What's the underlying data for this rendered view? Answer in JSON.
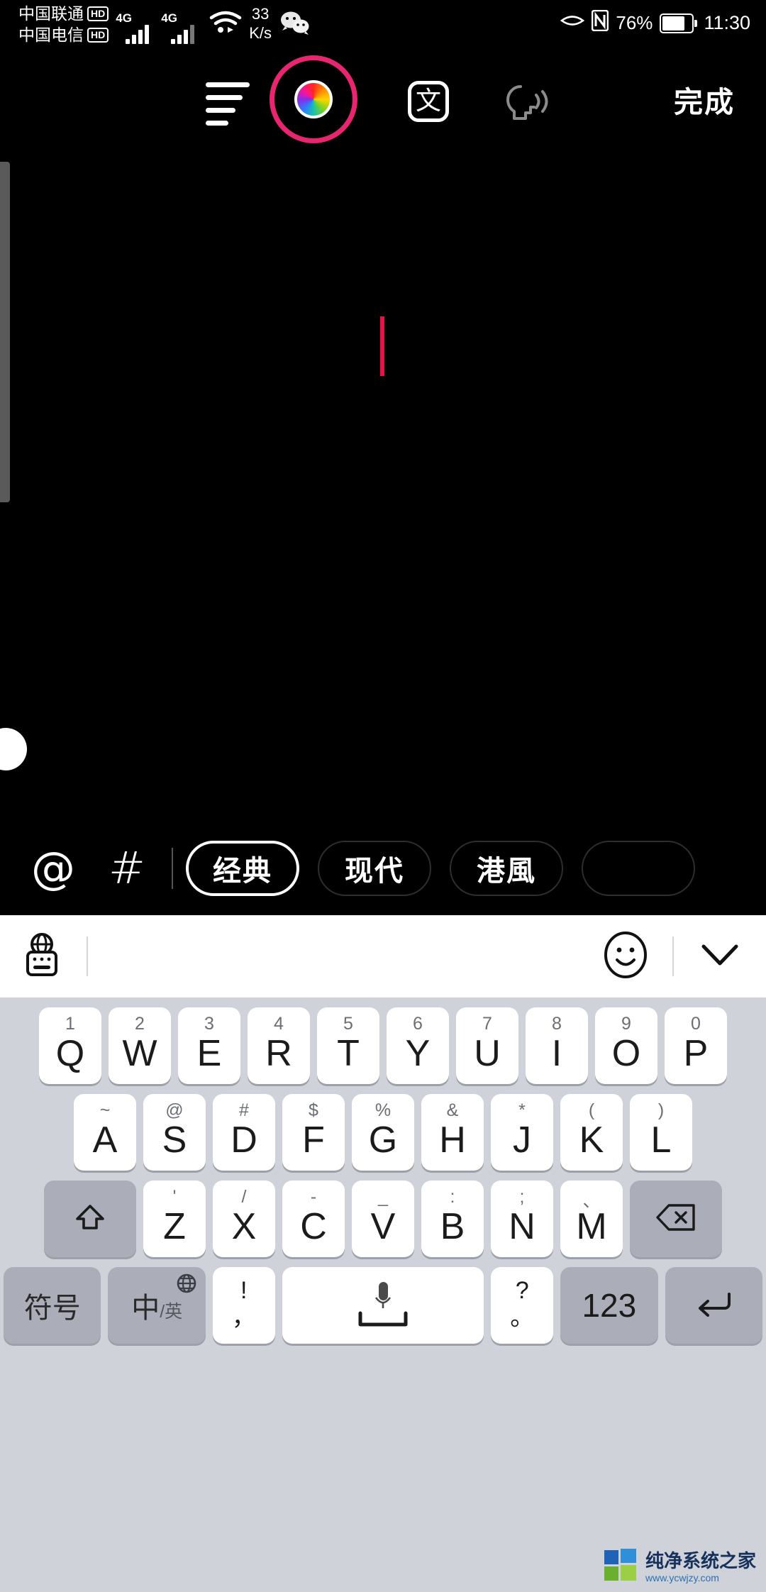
{
  "statusbar": {
    "carrier1": "中国联通",
    "carrier1_badge": "HD",
    "carrier2": "中国电信",
    "carrier2_badge": "HD",
    "network1": "4G",
    "network2": "4G",
    "netspeed_value": "33",
    "netspeed_unit": "K/s",
    "battery_percent": "76%",
    "clock": "11:30",
    "icons": [
      "wifi-icon",
      "wechat-icon",
      "eye-comfort-icon",
      "nfc-icon",
      "battery-icon"
    ]
  },
  "editor_toolbar": {
    "align_icon": "text-align-icon",
    "color_icon": "color-wheel-icon",
    "translate_label": "文",
    "speak_icon": "text-to-speech-icon",
    "done_label": "完成"
  },
  "canvas": {
    "caret_color": "#e8124a",
    "text_value": ""
  },
  "chipbar": {
    "mention_label": "@",
    "hashtag_label": "#",
    "styles": [
      {
        "label": "经典",
        "selected": true
      },
      {
        "label": "现代",
        "selected": false
      },
      {
        "label": "港風",
        "selected": false
      },
      {
        "label": "",
        "selected": false
      }
    ]
  },
  "keyboard": {
    "toolbar": {
      "ime_icon": "globe-keyboard-icon",
      "emoji_icon": "emoji-smiley-icon",
      "collapse_icon": "chevron-down-icon"
    },
    "row1": [
      {
        "sub": "1",
        "main": "Q"
      },
      {
        "sub": "2",
        "main": "W"
      },
      {
        "sub": "3",
        "main": "E"
      },
      {
        "sub": "4",
        "main": "R"
      },
      {
        "sub": "5",
        "main": "T"
      },
      {
        "sub": "6",
        "main": "Y"
      },
      {
        "sub": "7",
        "main": "U"
      },
      {
        "sub": "8",
        "main": "I"
      },
      {
        "sub": "9",
        "main": "O"
      },
      {
        "sub": "0",
        "main": "P"
      }
    ],
    "row2": [
      {
        "sub": "~",
        "main": "A"
      },
      {
        "sub": "@",
        "main": "S"
      },
      {
        "sub": "#",
        "main": "D"
      },
      {
        "sub": "$",
        "main": "F"
      },
      {
        "sub": "%",
        "main": "G"
      },
      {
        "sub": "&",
        "main": "H"
      },
      {
        "sub": "*",
        "main": "J"
      },
      {
        "sub": "(",
        "main": "K"
      },
      {
        "sub": ")",
        "main": "L"
      }
    ],
    "row3": [
      {
        "sub": "'",
        "main": "Z"
      },
      {
        "sub": "/",
        "main": "X"
      },
      {
        "sub": "-",
        "main": "C"
      },
      {
        "sub": "_",
        "main": "V"
      },
      {
        "sub": ":",
        "main": "B"
      },
      {
        "sub": ";",
        "main": "N"
      },
      {
        "sub": "、",
        "main": "M"
      }
    ],
    "shift_icon": "shift-icon",
    "backspace_icon": "backspace-icon",
    "row4": {
      "symbols_label": "符号",
      "lang_main": "中",
      "lang_sub": "/英",
      "lang_globe_icon": "globe-icon",
      "comma_top": "!",
      "comma_bottom": "，",
      "space_icon": "microphone-icon",
      "period_top": "?",
      "period_bottom": "。",
      "numeric_label": "123",
      "enter_icon": "enter-icon"
    }
  },
  "watermark": {
    "title": "纯净系统之家",
    "url": "www.ycwjzy.com"
  }
}
